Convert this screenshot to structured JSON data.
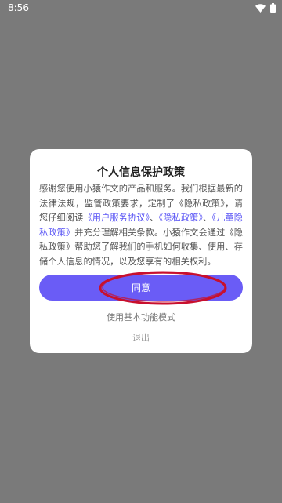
{
  "status_bar": {
    "time": "8:56",
    "icons": [
      "wifi-icon",
      "battery-icon"
    ]
  },
  "dialog": {
    "title": "个人信息保护政策",
    "body": {
      "text1": "感谢您使用小猿作文的产品和服务。我们根据最新的法律法规，监管政策要求，定制了《隐私政策》，请您仔细阅读",
      "link1": "《用户服务协议》",
      "sep1": "、",
      "link2": "《隐私政策》",
      "sep2": "、",
      "link3": "《儿童隐私政策》",
      "text2": "并充分理解相关条款。小猿作文会通过《隐私政策》帮助您了解我们的手机如何收集、使用、存储个人信息的情况，以及您享有的相关权利。"
    },
    "agree_label": "同意",
    "basic_mode_label": "使用基本功能模式",
    "exit_label": "退出"
  },
  "colors": {
    "overlay": "#7a7a7a",
    "accent": "#6a5cf6",
    "link": "#5a55f5",
    "annotation": "#c8102e"
  }
}
